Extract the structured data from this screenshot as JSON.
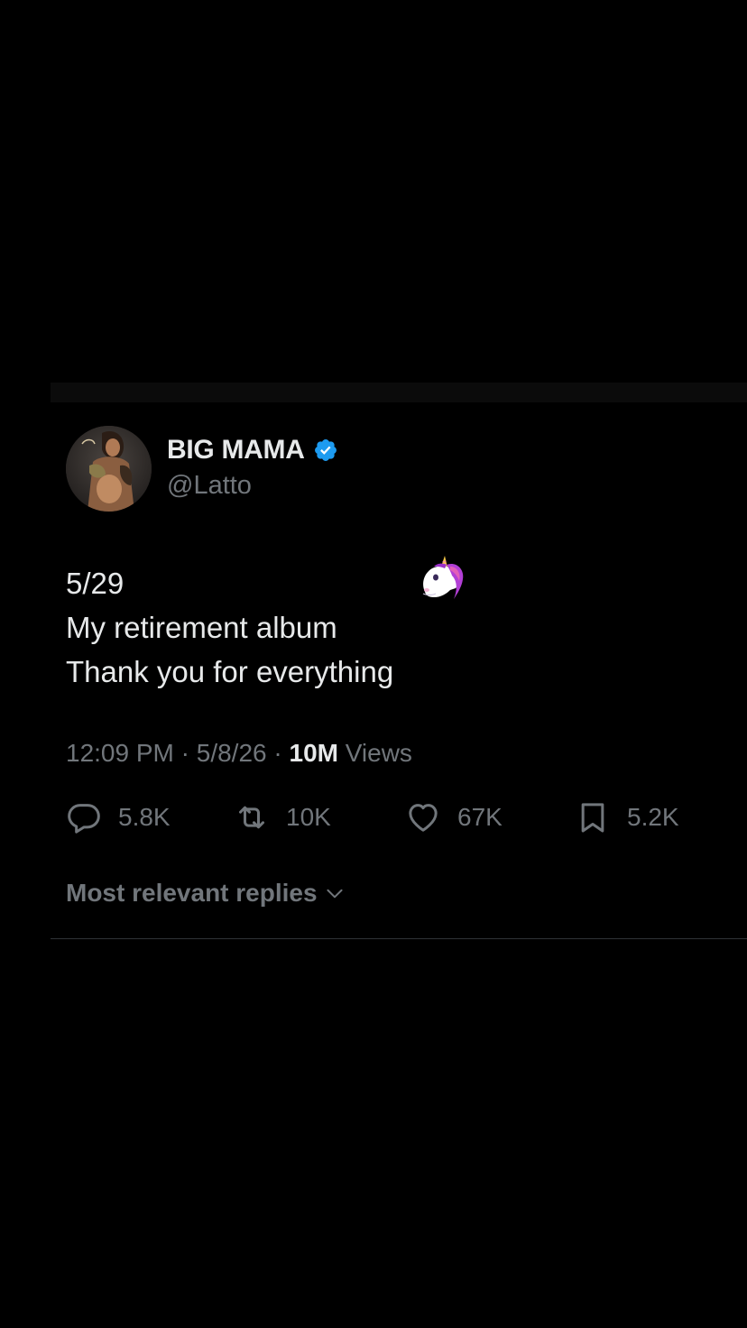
{
  "tweet": {
    "author": {
      "display_name": "BIG MAMA",
      "handle": "@Latto",
      "verified": true,
      "verified_color": "#1d9bf0"
    },
    "text_lines": [
      "5/29",
      "My retirement album",
      "Thank you for everything"
    ],
    "emoji": "unicorn-icon",
    "meta": {
      "time": "12:09 PM",
      "separator": " · ",
      "date": "5/8/26",
      "views_count": "10M",
      "views_label": " Views"
    },
    "actions": {
      "replies": "5.8K",
      "reposts": "10K",
      "likes": "67K",
      "bookmarks": "5.2K"
    },
    "replies_sort_label": "Most relevant replies"
  },
  "colors": {
    "background": "#000000",
    "primary_text": "#e7e9ea",
    "secondary_text": "#71767b",
    "divider": "#2f3336"
  }
}
